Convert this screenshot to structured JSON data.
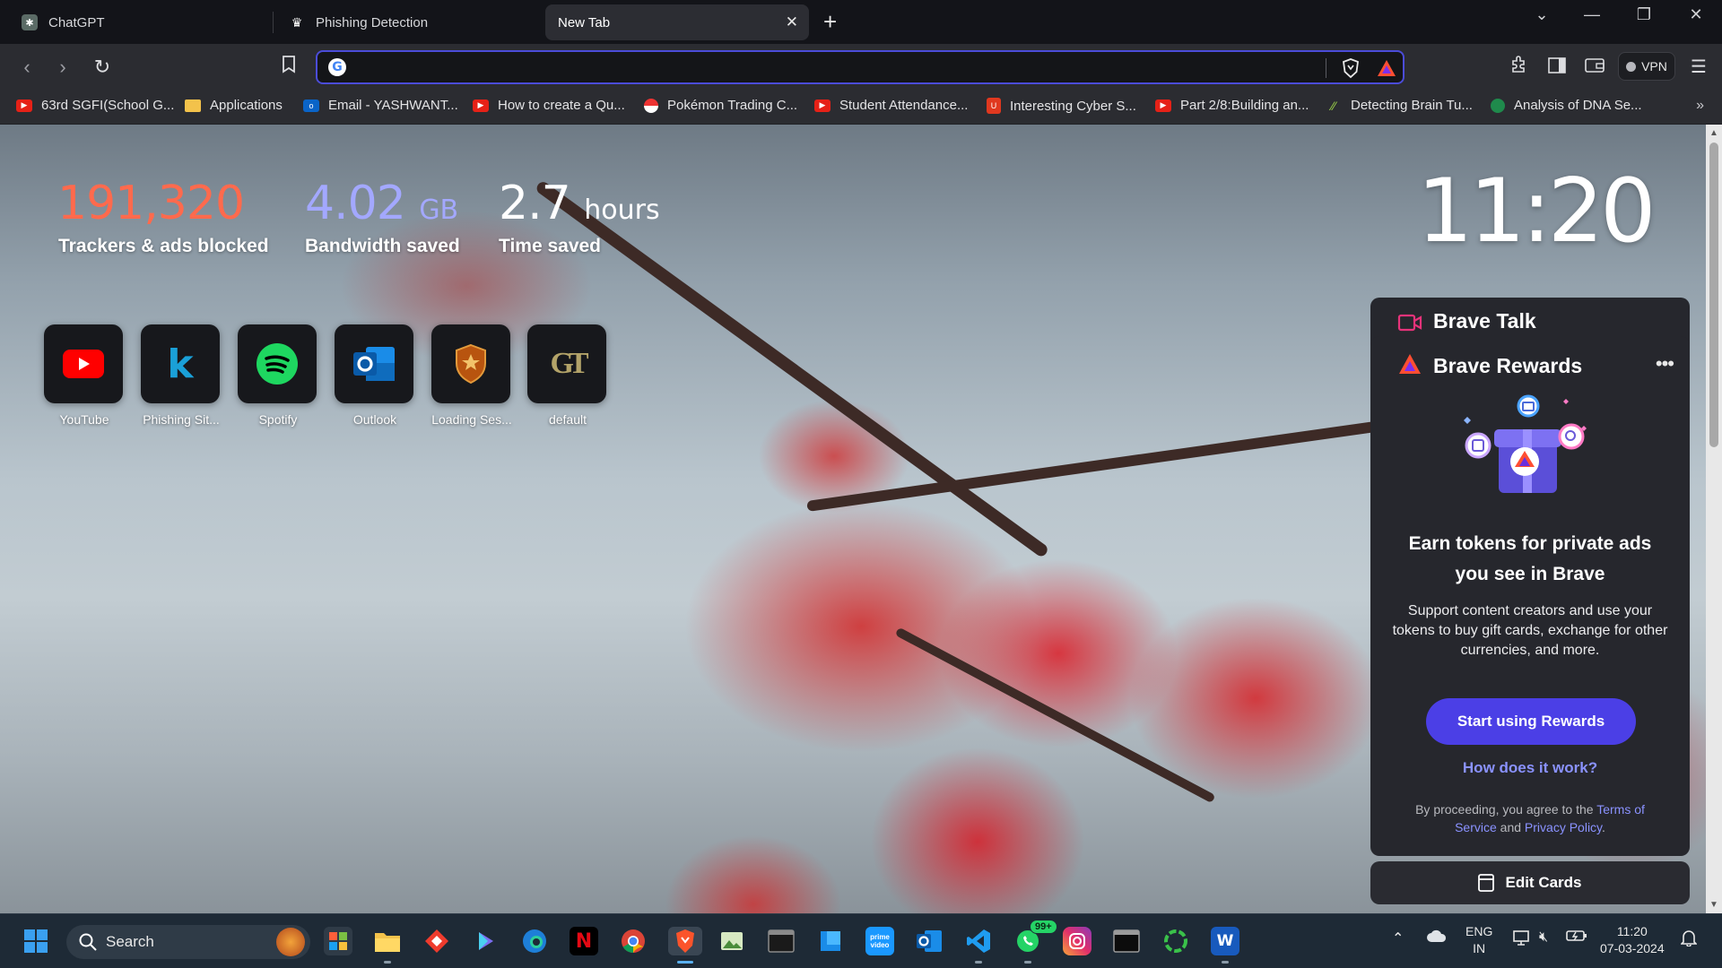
{
  "tabs": [
    {
      "title": "ChatGPT"
    },
    {
      "title": "Phishing Detection"
    },
    {
      "title": "New Tab"
    }
  ],
  "new_tab_symbol": "+",
  "window_controls": {
    "menu": "⌄",
    "minimize": "—",
    "restore": "❐",
    "close": "✕"
  },
  "toolbar": {
    "url_value": "",
    "vpn_label": "VPN"
  },
  "bookmarks": [
    {
      "label": "63rd SGFI(School G...",
      "icon": "youtube-icon"
    },
    {
      "label": "Applications",
      "icon": "folder-icon"
    },
    {
      "label": "Email - YASHWANT...",
      "icon": "outlook-icon"
    },
    {
      "label": "How to create a Qu...",
      "icon": "youtube-icon"
    },
    {
      "label": "Pokémon Trading C...",
      "icon": "pokeball-icon"
    },
    {
      "label": "Student Attendance...",
      "icon": "youtube-icon"
    },
    {
      "label": "Interesting Cyber S...",
      "icon": "shield-icon"
    },
    {
      "label": "Part 2/8:Building an...",
      "icon": "youtube-icon"
    },
    {
      "label": "Detecting Brain Tu...",
      "icon": "leaf-icon"
    },
    {
      "label": "Analysis of DNA Se...",
      "icon": "circle-icon"
    }
  ],
  "bookmarks_overflow": "»",
  "stats": {
    "trackers": {
      "value": "191,320",
      "label": "Trackers & ads blocked",
      "color": "#ff6a4d"
    },
    "bandwidth": {
      "value": "4.02",
      "unit": "GB",
      "label": "Bandwidth saved",
      "color": "#a3a8ff"
    },
    "time": {
      "value": "2.7",
      "unit": "hours",
      "label": "Time saved",
      "color": "#ffffff"
    }
  },
  "clock": "11:20",
  "top_sites": [
    {
      "name": "YouTube"
    },
    {
      "name": "Phishing Sit..."
    },
    {
      "name": "Spotify"
    },
    {
      "name": "Outlook"
    },
    {
      "name": "Loading Ses..."
    },
    {
      "name": "default"
    }
  ],
  "brave_talk": {
    "title": "Brave Talk"
  },
  "brave_rewards": {
    "title": "Brave Rewards",
    "more": "•••",
    "headline": "Earn tokens for private ads you see in Brave",
    "body": "Support content creators and use your tokens to buy gift cards, exchange for other currencies, and more.",
    "cta": "Start using Rewards",
    "howto": "How does it work?",
    "legal_prefix": "By proceeding, you agree to the",
    "legal_terms": "Terms of Service",
    "legal_and": "and",
    "legal_privacy": "Privacy Policy",
    "legal_suffix": "."
  },
  "edit_cards": "Edit Cards",
  "taskbar": {
    "search_placeholder": "Search",
    "whatsapp_badge": "99+",
    "language": {
      "line1": "ENG",
      "line2": "IN"
    },
    "time": "11:20",
    "date": "07-03-2024"
  },
  "colors": {
    "accent": "#4b3fe6",
    "link": "#8a92ff",
    "url_border": "#4b4cd8"
  }
}
